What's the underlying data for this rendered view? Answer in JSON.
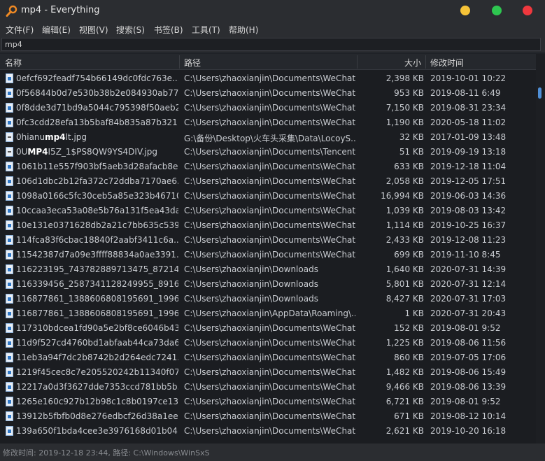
{
  "window": {
    "title": "mp4 - Everything",
    "colors": {
      "minimize": "#f6c338",
      "maximize": "#2ec650",
      "close": "#f0383e"
    }
  },
  "menu": [
    {
      "label": "文件(F)"
    },
    {
      "label": "编辑(E)"
    },
    {
      "label": "视图(V)"
    },
    {
      "label": "搜索(S)"
    },
    {
      "label": "书签(B)"
    },
    {
      "label": "工具(T)"
    },
    {
      "label": "帮助(H)"
    }
  ],
  "search": {
    "value": "mp4"
  },
  "columns": {
    "name": "名称",
    "path": "路径",
    "size": "大小",
    "date": "修改时间"
  },
  "rows": [
    {
      "name": "0efcf692feadf754b66149dc0fdc763e....",
      "path": "C:\\Users\\zhaoxianjin\\Documents\\WeChat...",
      "size": "2,398 KB",
      "date": "2019-10-01 10:22",
      "icon": "video-file-icon"
    },
    {
      "name": "0f56844b0d7e530b38b2e084930ab77...",
      "path": "C:\\Users\\zhaoxianjin\\Documents\\WeChat...",
      "size": "953 KB",
      "date": "2019-08-11 6:49",
      "icon": "video-file-icon"
    },
    {
      "name": "0f8dde3d71bd9a5044c795398f50aeb2...",
      "path": "C:\\Users\\zhaoxianjin\\Documents\\WeChat...",
      "size": "7,150 KB",
      "date": "2019-08-31 23:34",
      "icon": "video-file-icon"
    },
    {
      "name": "0fc3cdd28efa13b5baf84b835a87b321....",
      "path": "C:\\Users\\zhaoxianjin\\Documents\\WeChat...",
      "size": "1,190 KB",
      "date": "2020-05-18 11:02",
      "icon": "video-file-icon"
    },
    {
      "name_pre": "0hianu",
      "name_hl": "mp4",
      "name_post": "lt.jpg",
      "path": "G:\\备份\\Desktop\\火车头采集\\Data\\LocoyS...",
      "size": "32 KB",
      "date": "2017-01-09 13:48",
      "icon": "image-file-icon"
    },
    {
      "name_pre": "0U",
      "name_hl": "MP4",
      "name_post": "I5Z_1$PS8QW9YS4DIV.jpg",
      "path": "C:\\Users\\zhaoxianjin\\Documents\\Tencent...",
      "size": "51 KB",
      "date": "2019-09-19 13:18",
      "icon": "image-file-icon"
    },
    {
      "name": "1061b11e557f903bf5aeb3d28afacb8e....",
      "path": "C:\\Users\\zhaoxianjin\\Documents\\WeChat...",
      "size": "633 KB",
      "date": "2019-12-18 11:04",
      "icon": "video-file-icon"
    },
    {
      "name": "106d1dbc2b12fa372c72ddba7170ae6...",
      "path": "C:\\Users\\zhaoxianjin\\Documents\\WeChat...",
      "size": "2,058 KB",
      "date": "2019-12-05 17:51",
      "icon": "video-file-icon"
    },
    {
      "name": "1098a0166c5fc30ceb5a85e323b46710....",
      "path": "C:\\Users\\zhaoxianjin\\Documents\\WeChat...",
      "size": "16,994 KB",
      "date": "2019-06-03 14:36",
      "icon": "video-file-icon"
    },
    {
      "name": "10ccaa3eca53a08e5b76a131f5ea43da...",
      "path": "C:\\Users\\zhaoxianjin\\Documents\\WeChat...",
      "size": "1,039 KB",
      "date": "2019-08-03 13:42",
      "icon": "video-file-icon"
    },
    {
      "name": "10e131e0371628db2a21c7bb635c539...",
      "path": "C:\\Users\\zhaoxianjin\\Documents\\WeChat...",
      "size": "1,114 KB",
      "date": "2019-10-25 16:37",
      "icon": "video-file-icon"
    },
    {
      "name": "114fca83f6cbac18840f2aabf3411c6a....",
      "path": "C:\\Users\\zhaoxianjin\\Documents\\WeChat...",
      "size": "2,433 KB",
      "date": "2019-12-08 11:23",
      "icon": "video-file-icon"
    },
    {
      "name": "11542387d7a09e3ffff88834a0ae3391....",
      "path": "C:\\Users\\zhaoxianjin\\Documents\\WeChat...",
      "size": "699 KB",
      "date": "2019-11-10 8:45",
      "icon": "video-file-icon"
    },
    {
      "name": "116223195_743782889713475_872142...",
      "path": "C:\\Users\\zhaoxianjin\\Downloads",
      "size": "1,640 KB",
      "date": "2020-07-31 14:39",
      "icon": "video-file-icon"
    },
    {
      "name": "116339456_2587341128249955_89160...",
      "path": "C:\\Users\\zhaoxianjin\\Downloads",
      "size": "5,801 KB",
      "date": "2020-07-31 12:14",
      "icon": "video-file-icon"
    },
    {
      "name": "116877861_1388606808195691_19963...",
      "path": "C:\\Users\\zhaoxianjin\\Downloads",
      "size": "8,427 KB",
      "date": "2020-07-31 17:03",
      "icon": "video-file-icon"
    },
    {
      "name": "116877861_1388606808195691_19963...",
      "path": "C:\\Users\\zhaoxianjin\\AppData\\Roaming\\...",
      "size": "1 KB",
      "date": "2020-07-31 20:43",
      "icon": "shortcut-file-icon"
    },
    {
      "name": "117310bdcea1fd90a5e2bf8ce6046b43...",
      "path": "C:\\Users\\zhaoxianjin\\Documents\\WeChat...",
      "size": "152 KB",
      "date": "2019-08-01 9:52",
      "icon": "video-file-icon"
    },
    {
      "name": "11d9f527cd4760bd1abfaab44ca73da6...",
      "path": "C:\\Users\\zhaoxianjin\\Documents\\WeChat...",
      "size": "1,225 KB",
      "date": "2019-08-06 11:56",
      "icon": "video-file-icon"
    },
    {
      "name": "11eb3a94f7dc2b8742b2d264edc7241...",
      "path": "C:\\Users\\zhaoxianjin\\Documents\\WeChat...",
      "size": "860 KB",
      "date": "2019-07-05 17:06",
      "icon": "video-file-icon"
    },
    {
      "name": "1219f45cec8c7e205520242b11340f07...",
      "path": "C:\\Users\\zhaoxianjin\\Documents\\WeChat...",
      "size": "1,482 KB",
      "date": "2019-08-06 15:49",
      "icon": "video-file-icon"
    },
    {
      "name": "12217a0d3f3627dde7353ccd781bb5b...",
      "path": "C:\\Users\\zhaoxianjin\\Documents\\WeChat...",
      "size": "9,466 KB",
      "date": "2019-08-06 13:39",
      "icon": "video-file-icon"
    },
    {
      "name": "1265e160c927b12b98c1c8b0197ce13c...",
      "path": "C:\\Users\\zhaoxianjin\\Documents\\WeChat...",
      "size": "6,721 KB",
      "date": "2019-08-01 9:52",
      "icon": "video-file-icon"
    },
    {
      "name": "13912b5fbfb0d8e276edbcf26d38a1ee...",
      "path": "C:\\Users\\zhaoxianjin\\Documents\\WeChat...",
      "size": "671 KB",
      "date": "2019-08-12 10:14",
      "icon": "video-file-icon"
    },
    {
      "name": "139a650f1bda4cee3e3976168d01b04...",
      "path": "C:\\Users\\zhaoxianjin\\Documents\\WeChat...",
      "size": "2,621 KB",
      "date": "2019-10-20 16:18",
      "icon": "video-file-icon"
    }
  ],
  "status": {
    "text": "修改时间: 2019-12-18 23:44, 路径: C:\\Windows\\WinSxS"
  }
}
